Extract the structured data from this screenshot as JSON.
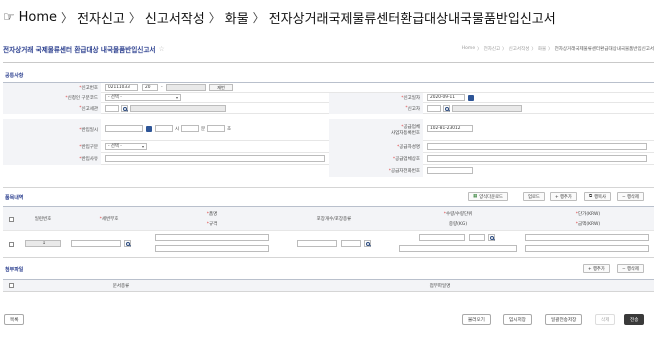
{
  "breadcrumb_top": {
    "hand": "☞",
    "items": [
      "Home",
      "전자신고",
      "신고서작성",
      "화물",
      "전자상거래국제물류센터환급대상내국물품반입신고서"
    ],
    "sep": "〉"
  },
  "page": {
    "title": "전자상거래 국제물류센터 환급대상 내국물품반입신고서",
    "star": "☆",
    "path": [
      "Home",
      "전자신고",
      "신고서작성",
      "화물",
      "전자상거래국제물류센터환급대상내국물품반입신고서"
    ],
    "path_sep": "〉"
  },
  "common": {
    "section_title": "공통사항",
    "report_no_label": "신고번호",
    "report_no_a": "02111033",
    "report_no_b": "20",
    "report_no_c": "-",
    "reissue": "재번",
    "applicant_type_label": "신청인 구분코드",
    "applicant_type_value": "- 선택 -",
    "report_date_label": "신고일자",
    "report_date_value": "2020-09-11",
    "customs_label": "신고세관",
    "declarant_label": "신고자",
    "entry_dt_label": "반입일시",
    "hour": "시",
    "minute": "분",
    "second": "초",
    "supplier_brn_label_1": "공급업체",
    "supplier_brn_label_2": "사업자등록번호",
    "supplier_brn_value": "102-81-23012",
    "entry_type_label": "반입구분",
    "entry_type_value": "- 선택 -",
    "supplier_name_label": "공급자성명",
    "entry_reason_label": "반입사유",
    "supplier_company_label": "공급업체상호",
    "supplier_phone_label": "공급자전화번호"
  },
  "items": {
    "section_title": "품목내역",
    "buttons": [
      "양식다운로드",
      "업로드",
      "+ 행추가",
      "행복사",
      "− 행삭제"
    ],
    "headers": {
      "no": "일련번호",
      "hs": "세번부호",
      "name": "품명",
      "spec": "규격",
      "pkg": "포장개수/포장종류",
      "qty": "수량/수량단위",
      "weight": "중량(KG)",
      "unit_price": "단가(KRW)",
      "amount": "금액(KRW)"
    },
    "row_no": "1"
  },
  "attach": {
    "section_title": "첨부파일",
    "buttons": [
      "+ 행추가",
      "− 행삭제"
    ],
    "headers": {
      "doc_type": "문서종류",
      "file_name": "첨부파일명"
    }
  },
  "footer": {
    "list": "목록",
    "load": "불러오기",
    "temp_save": "임시저장",
    "bulk_save": "일괄전송저장",
    "delete": "삭제",
    "send": "전송"
  }
}
